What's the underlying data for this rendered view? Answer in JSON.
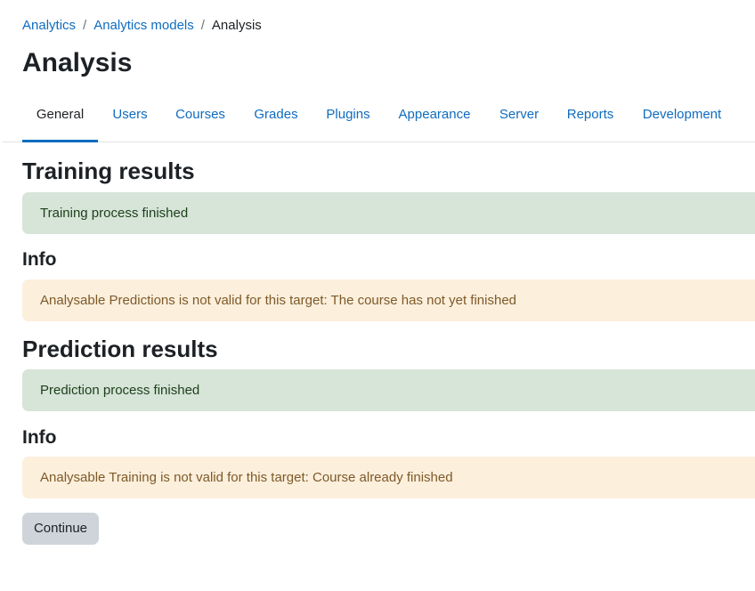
{
  "breadcrumb": {
    "items": [
      "Analytics",
      "Analytics models"
    ],
    "separator": "/",
    "current": "Analysis"
  },
  "page_title": "Analysis",
  "tabs": [
    {
      "label": "General",
      "active": true
    },
    {
      "label": "Users",
      "active": false
    },
    {
      "label": "Courses",
      "active": false
    },
    {
      "label": "Grades",
      "active": false
    },
    {
      "label": "Plugins",
      "active": false
    },
    {
      "label": "Appearance",
      "active": false
    },
    {
      "label": "Server",
      "active": false
    },
    {
      "label": "Reports",
      "active": false
    },
    {
      "label": "Development",
      "active": false
    }
  ],
  "training": {
    "heading": "Training results",
    "status": "Training process finished",
    "info_heading": "Info",
    "info_message": "Analysable Predictions is not valid for this target: The course has not yet finished"
  },
  "prediction": {
    "heading": "Prediction results",
    "status": "Prediction process finished",
    "info_heading": "Info",
    "info_message": "Analysable Training is not valid for this target: Course already finished"
  },
  "continue_label": "Continue",
  "colors": {
    "link": "#0f6cbf",
    "success_bg": "#d7e4d8",
    "warning_bg": "#fcefdc",
    "button_bg": "#ced4da"
  }
}
